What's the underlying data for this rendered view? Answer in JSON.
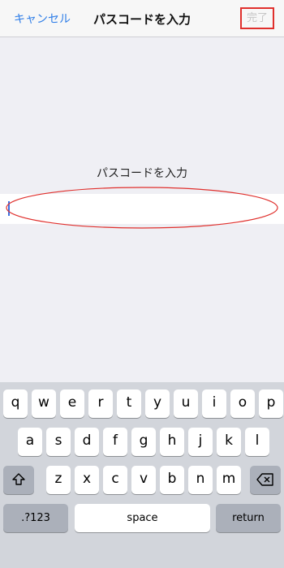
{
  "nav": {
    "cancel_label": "キャンセル",
    "title": "パスコードを入力",
    "done_label": "完了"
  },
  "prompt": "パスコードを入力",
  "passcode": {
    "value": "",
    "placeholder": ""
  },
  "keyboard": {
    "row1": [
      "q",
      "w",
      "e",
      "r",
      "t",
      "y",
      "u",
      "i",
      "o",
      "p"
    ],
    "row2": [
      "a",
      "s",
      "d",
      "f",
      "g",
      "h",
      "j",
      "k",
      "l"
    ],
    "row3": [
      "z",
      "x",
      "c",
      "v",
      "b",
      "n",
      "m"
    ],
    "numbers_label": ".?123",
    "space_label": "space",
    "return_label": "return"
  },
  "colors": {
    "accent": "#2f7ee8",
    "highlight_red": "#e0302d",
    "keyboard_bg": "#d2d5db"
  }
}
